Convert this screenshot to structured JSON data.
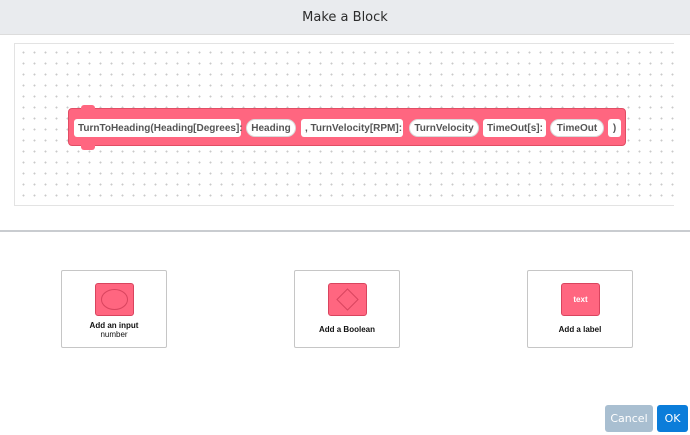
{
  "dialog": {
    "title": "Make a Block"
  },
  "block": {
    "segments": [
      {
        "kind": "label",
        "text": "TurnToHeading(Heading[Degrees]:"
      },
      {
        "kind": "input",
        "text": "Heading"
      },
      {
        "kind": "label",
        "text": ", TurnVelocity[RPM]:"
      },
      {
        "kind": "input",
        "text": "TurnVelocity"
      },
      {
        "kind": "label",
        "text": "TimeOut[s]:"
      },
      {
        "kind": "input",
        "text": "TimeOut"
      },
      {
        "kind": "label",
        "text": ")"
      }
    ],
    "color": "#ff6680"
  },
  "options": {
    "input": {
      "label": "Add an input",
      "sub": "number",
      "icon": "number-input-icon"
    },
    "boolean": {
      "label": "Add a Boolean",
      "icon": "boolean-input-icon"
    },
    "label": {
      "label": "Add a label",
      "icon_text": "text",
      "icon": "text-label-icon"
    }
  },
  "buttons": {
    "cancel": "Cancel",
    "ok": "OK"
  },
  "colors": {
    "accent": "#0b7dda",
    "disabled": "#a9bfd1",
    "block": "#ff6680"
  }
}
